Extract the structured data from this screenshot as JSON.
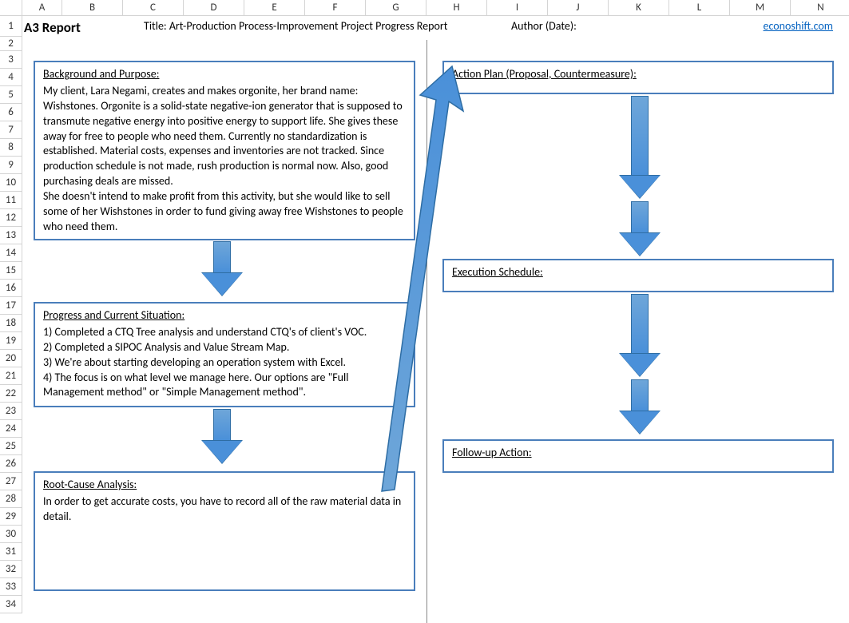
{
  "columns": [
    "A",
    "B",
    "C",
    "D",
    "E",
    "F",
    "G",
    "H",
    "I",
    "J",
    "K",
    "L",
    "M",
    "N"
  ],
  "rows_count": 34,
  "header": {
    "main": "A3 Report",
    "subtitle": "Title: Art-Production Process-Improvement Project Progress Report",
    "author": "Author (Date):",
    "link": "econoshift.com"
  },
  "boxes": {
    "background": {
      "heading": "Background and Purpose:",
      "body": "My client, Lara Negami, creates and makes orgonite, her brand name: Wishstones.  Orgonite is a solid-state negative-ion generator that is supposed to transmute negative energy into positive energy to support life.  She gives these away for free to people who need them.  Currently no standardization is established.  Material costs, expenses and inventories are not tracked.  Since production schedule is not made, rush production is normal now.  Also, good purchasing deals are missed.\nShe doesn't intend to make profit from this activity, but she would like to sell some of her Wishstones in order to fund giving away free Wishstones to people who need them."
    },
    "progress": {
      "heading": "Progress and Current Situation:",
      "body": "1) Completed a CTQ Tree analysis and understand CTQ's of client's VOC.\n2) Completed a SIPOC Analysis and Value Stream Map.\n3) We're about starting developing an operation system with Excel.\n4) The focus is on what level we manage here.  Our options are \"Full Management method\" or \"Simple Management method\"."
    },
    "rootcause": {
      "heading": "Root-Cause Analysis:",
      "body": "In order to get accurate costs, you have to record all of the raw material data in detail."
    },
    "action": {
      "heading": "Action Plan (Proposal, Countermeasure):",
      "body": ""
    },
    "schedule": {
      "heading": "Execution Schedule:",
      "body": ""
    },
    "followup": {
      "heading": "Follow-up Action:",
      "body": ""
    }
  }
}
